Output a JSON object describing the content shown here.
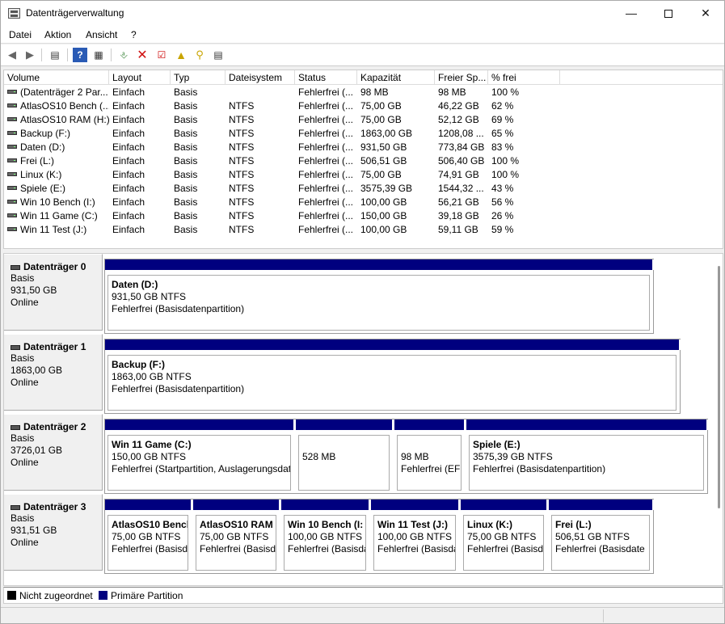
{
  "window": {
    "title": "Datenträgerverwaltung"
  },
  "menu": [
    "Datei",
    "Aktion",
    "Ansicht",
    "?"
  ],
  "toolbar": [
    "back-icon",
    "forward-icon",
    "console-tree-icon",
    "help-icon",
    "list-view-icon",
    "rescan-icon",
    "delete-icon",
    "properties-icon",
    "folder-up-icon",
    "search-icon",
    "export-icon"
  ],
  "columns": [
    "Volume",
    "Layout",
    "Typ",
    "Dateisystem",
    "Status",
    "Kapazität",
    "Freier Sp...",
    "% frei"
  ],
  "volumes": [
    [
      "(Datenträger 2 Par...",
      "Einfach",
      "Basis",
      "",
      "Fehlerfrei (...",
      "98 MB",
      "98 MB",
      "100 %"
    ],
    [
      "AtlasOS10 Bench (...",
      "Einfach",
      "Basis",
      "NTFS",
      "Fehlerfrei (...",
      "75,00 GB",
      "46,22 GB",
      "62 %"
    ],
    [
      "AtlasOS10 RAM (H:)",
      "Einfach",
      "Basis",
      "NTFS",
      "Fehlerfrei (...",
      "75,00 GB",
      "52,12 GB",
      "69 %"
    ],
    [
      "Backup (F:)",
      "Einfach",
      "Basis",
      "NTFS",
      "Fehlerfrei (...",
      "1863,00 GB",
      "1208,08 ...",
      "65 %"
    ],
    [
      "Daten (D:)",
      "Einfach",
      "Basis",
      "NTFS",
      "Fehlerfrei (...",
      "931,50 GB",
      "773,84 GB",
      "83 %"
    ],
    [
      "Frei (L:)",
      "Einfach",
      "Basis",
      "NTFS",
      "Fehlerfrei (...",
      "506,51 GB",
      "506,40 GB",
      "100 %"
    ],
    [
      "Linux (K:)",
      "Einfach",
      "Basis",
      "NTFS",
      "Fehlerfrei (...",
      "75,00 GB",
      "74,91 GB",
      "100 %"
    ],
    [
      "Spiele (E:)",
      "Einfach",
      "Basis",
      "NTFS",
      "Fehlerfrei (...",
      "3575,39 GB",
      "1544,32 ...",
      "43 %"
    ],
    [
      "Win 10 Bench (I:)",
      "Einfach",
      "Basis",
      "NTFS",
      "Fehlerfrei (...",
      "100,00 GB",
      "56,21 GB",
      "56 %"
    ],
    [
      "Win 11 Game (C:)",
      "Einfach",
      "Basis",
      "NTFS",
      "Fehlerfrei (...",
      "150,00 GB",
      "39,18 GB",
      "26 %"
    ],
    [
      "Win 11 Test (J:)",
      "Einfach",
      "Basis",
      "NTFS",
      "Fehlerfrei (...",
      "100,00 GB",
      "59,11 GB",
      "59 %"
    ]
  ],
  "disks": [
    {
      "name": "Datenträger 0",
      "type": "Basis",
      "size": "931,50 GB",
      "state": "Online",
      "partitions": [
        {
          "name": "Daten  (D:)",
          "line1": "931,50 GB NTFS",
          "line2": "Fehlerfrei (Basisdatenpartition)"
        }
      ]
    },
    {
      "name": "Datenträger 1",
      "type": "Basis",
      "size": "1863,00 GB",
      "state": "Online",
      "partitions": [
        {
          "name": "Backup  (F:)",
          "line1": "1863,00 GB NTFS",
          "line2": "Fehlerfrei (Basisdatenpartition)"
        }
      ]
    },
    {
      "name": "Datenträger 2",
      "type": "Basis",
      "size": "3726,01 GB",
      "state": "Online",
      "partitions": [
        {
          "name": "Win 11 Game  (C:)",
          "line1": "150,00 GB NTFS",
          "line2": "Fehlerfrei (Startpartition, Auslagerungsdat"
        },
        {
          "name": "",
          "line1": "528 MB",
          "line2": ""
        },
        {
          "name": "",
          "line1": "98 MB",
          "line2": "Fehlerfrei (EFI-"
        },
        {
          "name": "Spiele  (E:)",
          "line1": "3575,39 GB NTFS",
          "line2": "Fehlerfrei (Basisdatenpartition)"
        }
      ]
    },
    {
      "name": "Datenträger 3",
      "type": "Basis",
      "size": "931,51 GB",
      "state": "Online",
      "partitions": [
        {
          "name": "AtlasOS10 Bench",
          "line1": "75,00 GB NTFS",
          "line2": "Fehlerfrei (Basisda"
        },
        {
          "name": "AtlasOS10 RAM",
          "line1": "75,00 GB NTFS",
          "line2": "Fehlerfrei (Basisda"
        },
        {
          "name": "Win 10 Bench  (I:",
          "line1": "100,00 GB NTFS",
          "line2": "Fehlerfrei (Basisda"
        },
        {
          "name": "Win 11 Test  (J:)",
          "line1": "100,00 GB NTFS",
          "line2": "Fehlerfrei (Basisda"
        },
        {
          "name": "Linux  (K:)",
          "line1": "75,00 GB NTFS",
          "line2": "Fehlerfrei (Basisda"
        },
        {
          "name": "Frei  (L:)",
          "line1": "506,51 GB NTFS",
          "line2": "Fehlerfrei (Basisdate"
        }
      ]
    }
  ],
  "legend": [
    {
      "label": "Nicht zugeordnet",
      "color": "#000000"
    },
    {
      "label": "Primäre Partition",
      "color": "#00007f"
    }
  ],
  "colors": {
    "partition_bar": "#00007f"
  }
}
